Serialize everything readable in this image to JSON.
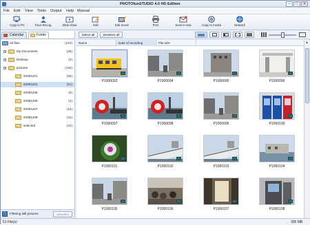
{
  "window": {
    "title": "PHOTOfunSTUDIO 4.0 HD Edition",
    "minimize": "–",
    "maximize": "□",
    "close": "×"
  },
  "menus": [
    "File",
    "Edit",
    "View",
    "Tools",
    "Output",
    "Help",
    "Manual"
  ],
  "toolbar": [
    {
      "label": "Copy to PC",
      "icon": "copy-to-pc-icon"
    },
    {
      "label": "Face Recog.",
      "icon": "face-recognition-icon"
    },
    {
      "label": "Slide show",
      "icon": "slide-show-icon"
    },
    {
      "label": "Edit",
      "icon": "edit-icon"
    },
    {
      "label": "Edit movie",
      "icon": "edit-movie-icon"
    },
    {
      "label": "Print",
      "icon": "printer-icon"
    },
    {
      "label": "Send e-mail",
      "icon": "email-icon"
    },
    {
      "label": "Copy to media",
      "icon": "copy-to-media-icon"
    },
    {
      "label": "Network",
      "icon": "network-icon"
    }
  ],
  "sidebar": {
    "tab_calendar": "Calendar",
    "tab_folder": "Folder",
    "tree": [
      {
        "label": "All files",
        "count": "(210)",
        "level": 0
      },
      {
        "label": "My Documents",
        "count": "(28)",
        "level": 1
      },
      {
        "label": "Desktop",
        "count": "(0)",
        "level": 1
      },
      {
        "label": "pictures",
        "count": "(182)",
        "level": 1
      },
      {
        "label": "20091201",
        "count": "(69)",
        "level": 2
      },
      {
        "label": "20091202",
        "count": "(51)",
        "level": 2,
        "selected": true
      },
      {
        "label": "20091205",
        "count": "(9)",
        "level": 2
      },
      {
        "label": "20091206",
        "count": "(4)",
        "level": 2
      },
      {
        "label": "20091207",
        "count": "(16)",
        "level": 2
      },
      {
        "label": "20091208",
        "count": "(11)",
        "level": 2
      },
      {
        "label": "selected",
        "count": "(22)",
        "level": 2
      }
    ],
    "filter_label": "Filtering still pictures",
    "filter_button": "Deselect"
  },
  "main": {
    "select_all": "Select all",
    "deselect_all": "Deselect all",
    "columns": [
      "Name",
      "Date of recording",
      "File size"
    ],
    "photos": [
      {
        "name": "P1000093",
        "scene": "train"
      },
      {
        "name": "P1000094",
        "scene": "street"
      },
      {
        "name": "P1000095",
        "scene": "building"
      },
      {
        "name": "P1000096",
        "scene": "station"
      },
      {
        "name": "P1000097",
        "scene": "redboat"
      },
      {
        "name": "P1000098",
        "scene": "redboat"
      },
      {
        "name": "P1000099",
        "scene": "street"
      },
      {
        "name": "P1000100",
        "scene": "vending"
      },
      {
        "name": "P1000101",
        "scene": "flower"
      },
      {
        "name": "P1000102",
        "scene": "ship"
      },
      {
        "name": "P1000103",
        "scene": "ship"
      },
      {
        "name": "P1000104",
        "scene": "harbor"
      },
      {
        "name": "P1000105",
        "scene": "street"
      },
      {
        "name": "P1000106",
        "scene": "crowd"
      },
      {
        "name": "P1000107",
        "scene": "hall"
      },
      {
        "name": "P1000108",
        "scene": "machine"
      }
    ]
  },
  "status": {
    "left": "51 File(s)",
    "right": "305 MB"
  }
}
